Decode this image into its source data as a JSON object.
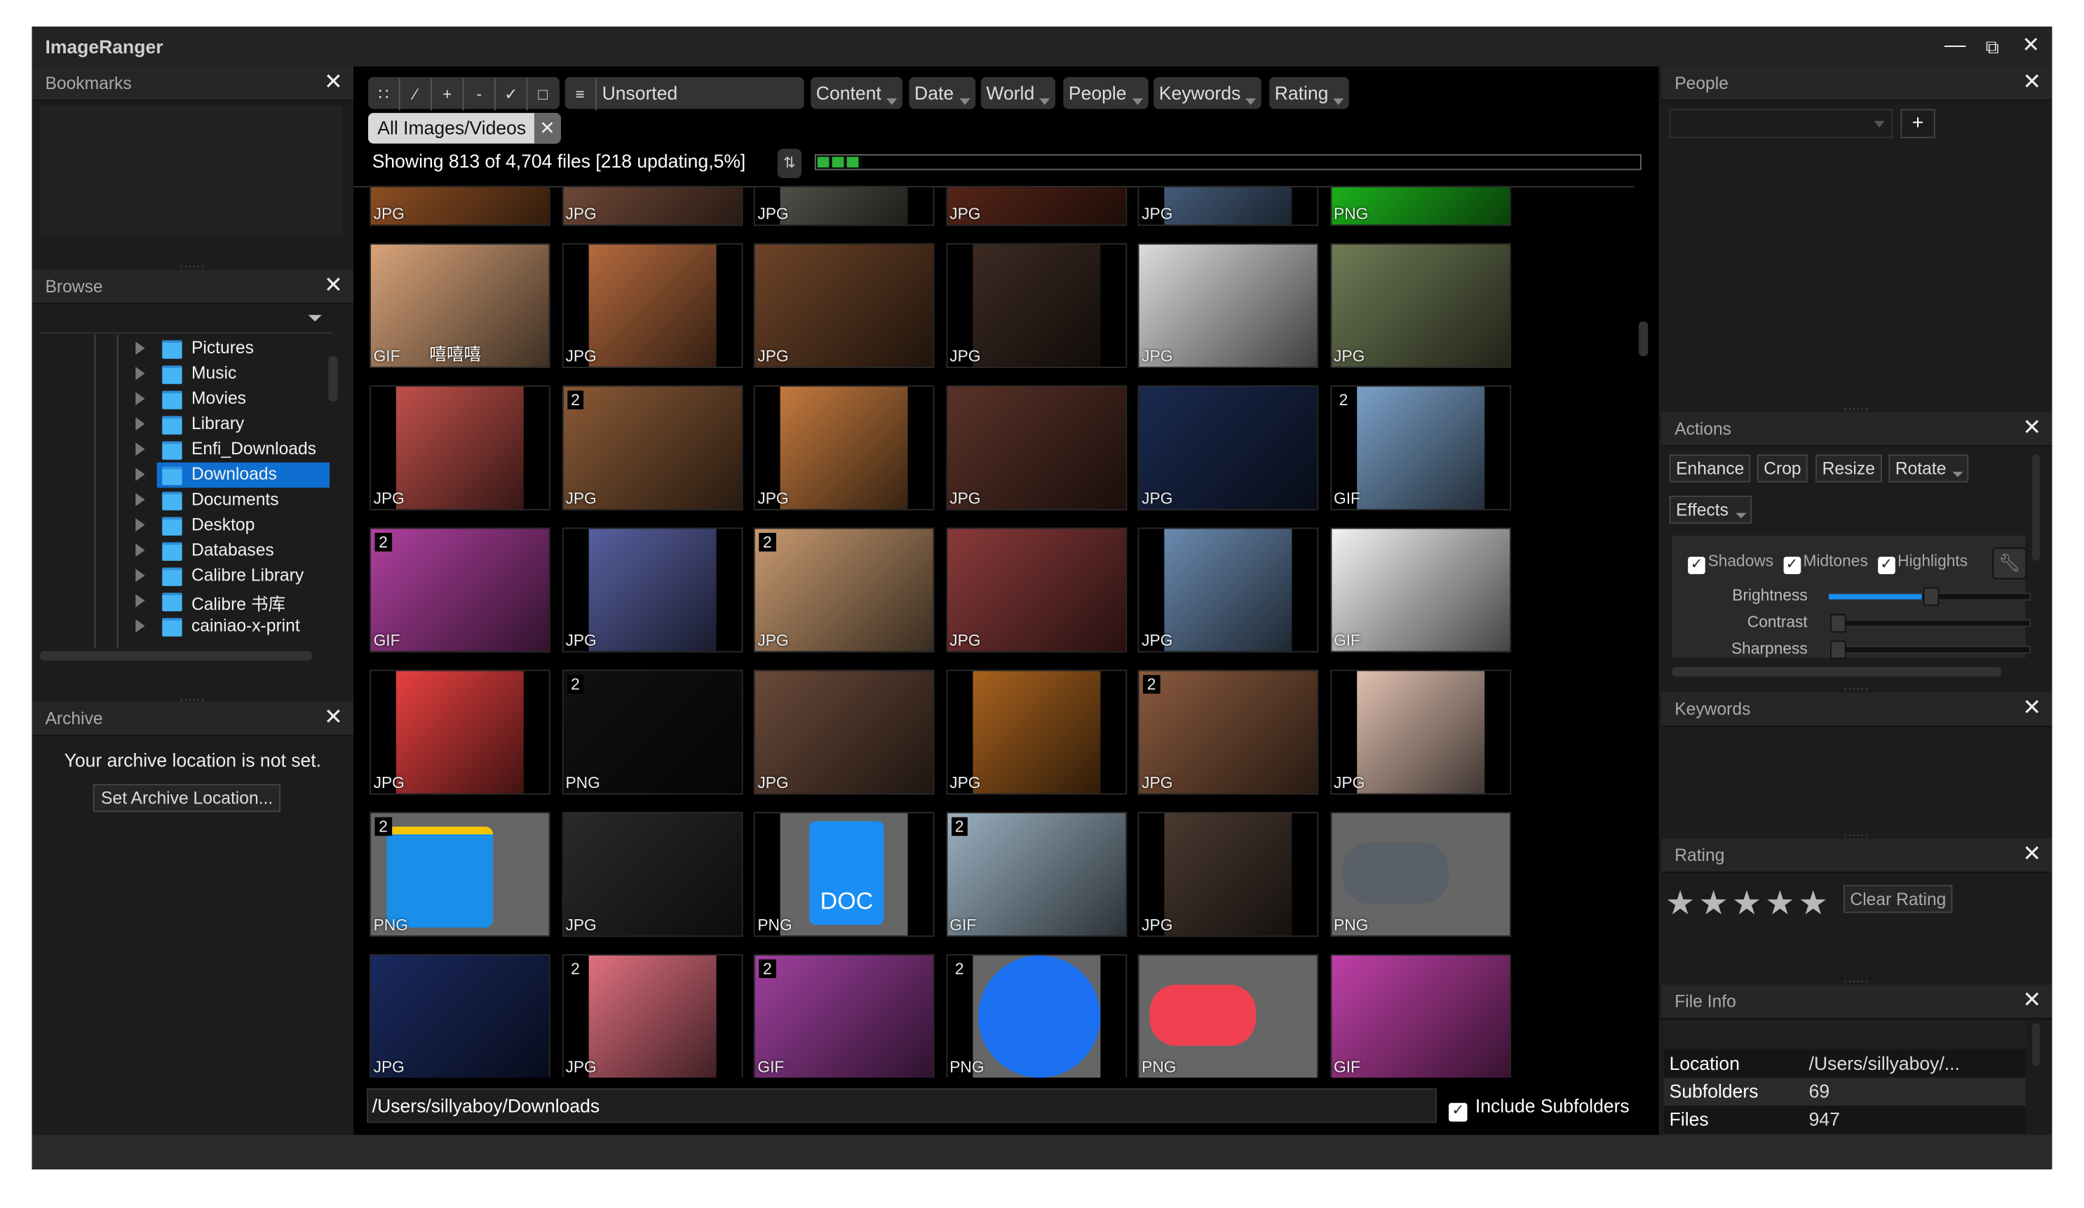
{
  "window": {
    "title": "ImageRanger",
    "controls": [
      "minimize-icon",
      "restore-icon",
      "close-icon"
    ]
  },
  "left": {
    "bookmarks": {
      "title": "Bookmarks"
    },
    "browse": {
      "title": "Browse",
      "folders": [
        {
          "label": "Pictures"
        },
        {
          "label": "Music"
        },
        {
          "label": "Movies"
        },
        {
          "label": "Library"
        },
        {
          "label": "Enfi_Downloads"
        },
        {
          "label": "Downloads",
          "selected": true
        },
        {
          "label": "Documents"
        },
        {
          "label": "Desktop"
        },
        {
          "label": "Databases"
        },
        {
          "label": "Calibre Library"
        },
        {
          "label": "Calibre 书库"
        },
        {
          "label": "cainiao-x-print"
        }
      ]
    },
    "archive": {
      "title": "Archive",
      "message": "Your archive location is not set.",
      "button": "Set Archive Location..."
    }
  },
  "toolbar": {
    "sort": "Unsorted",
    "filters": [
      "Content",
      "Date",
      "World",
      "People",
      "Keywords",
      "Rating"
    ],
    "chip": "All Images/Videos",
    "status": "Showing 813 of 4,704 files [218 updating,5%]",
    "progress_percent": 5,
    "progress_color": "#2fb33a"
  },
  "grid": {
    "tiles": [
      {
        "type": "JPG",
        "color": "#b0622c"
      },
      {
        "type": "JPG",
        "color": "#8a5a45"
      },
      {
        "type": "JPG",
        "color": "#6a6a60"
      },
      {
        "type": "JPG",
        "color": "#6b2e1e"
      },
      {
        "type": "JPG",
        "color": "#5a78a0"
      },
      {
        "type": "PNG",
        "color": "#22dd22"
      },
      {
        "type": "GIF",
        "color": "#d9a47a",
        "caption": "嘻嘻嘻"
      },
      {
        "type": "JPG",
        "color": "#b56a3e"
      },
      {
        "type": "JPG",
        "color": "#6e4428"
      },
      {
        "type": "JPG",
        "color": "#3c2a22"
      },
      {
        "type": "JPG",
        "color": "#dcdcdc"
      },
      {
        "type": "JPG",
        "color": "#6f7a55"
      },
      {
        "type": "JPG",
        "color": "#c0504a"
      },
      {
        "type": "JPG",
        "count": "2",
        "color": "#8a5a36"
      },
      {
        "type": "JPG",
        "color": "#c47a3e"
      },
      {
        "type": "JPG",
        "color": "#5a3228"
      },
      {
        "type": "JPG",
        "color": "#1a2a50"
      },
      {
        "type": "GIF",
        "count": "2",
        "color": "#7aa0c8"
      },
      {
        "type": "GIF",
        "count": "2",
        "color": "#b040a0"
      },
      {
        "type": "JPG",
        "color": "#5860a0"
      },
      {
        "type": "JPG",
        "count": "2",
        "color": "#c89a70"
      },
      {
        "type": "JPG",
        "color": "#8a3a3a"
      },
      {
        "type": "JPG",
        "color": "#6a8ab0"
      },
      {
        "type": "GIF",
        "color": "#f2f2f2"
      },
      {
        "type": "JPG",
        "color": "#e84040"
      },
      {
        "type": "PNG",
        "count": "2",
        "color": "#111111"
      },
      {
        "type": "JPG",
        "color": "#6a4a3a"
      },
      {
        "type": "JPG",
        "color": "#a8621e"
      },
      {
        "type": "JPG",
        "count": "2",
        "color": "#8a5a3e"
      },
      {
        "type": "JPG",
        "color": "#e0c0b0"
      },
      {
        "type": "PNG",
        "count": "2",
        "color": "#1a8ee8",
        "icon": "folder-icon"
      },
      {
        "type": "JPG",
        "color": "#2a2a2a"
      },
      {
        "type": "PNG",
        "color": "#1a8ef5",
        "label": "DOC"
      },
      {
        "type": "GIF",
        "count": "2",
        "color": "#9ab0c0"
      },
      {
        "type": "JPG",
        "color": "#4a3a30"
      },
      {
        "type": "PNG",
        "color": "#5a6068",
        "icon": "gamepad-icon"
      },
      {
        "type": "JPG",
        "color": "#1a2a60"
      },
      {
        "type": "JPG",
        "count": "2",
        "color": "#e07080"
      },
      {
        "type": "GIF",
        "count": "2",
        "color": "#a040a0"
      },
      {
        "type": "PNG",
        "count": "2",
        "color": "#1a70f0",
        "icon": "app-store-icon"
      },
      {
        "type": "PNG",
        "color": "#f04050",
        "icon": "gamepad-icon"
      },
      {
        "type": "GIF",
        "color": "#c040a8"
      }
    ]
  },
  "footer": {
    "path": "/Users/sillyaboy/Downloads",
    "include_subfolders": "Include Subfolders",
    "include_checked": true
  },
  "right": {
    "people": {
      "title": "People",
      "add": "+"
    },
    "actions": {
      "title": "Actions",
      "buttons": [
        "Enhance",
        "Crop",
        "Resize",
        "Rotate"
      ],
      "effects": "Effects",
      "checks": [
        "Shadows",
        "Midtones",
        "Highlights"
      ],
      "sliders": [
        {
          "label": "Brightness",
          "value": 0.5
        },
        {
          "label": "Contrast",
          "value": 0
        },
        {
          "label": "Sharpness",
          "value": 0
        }
      ]
    },
    "keywords": {
      "title": "Keywords"
    },
    "rating": {
      "title": "Rating",
      "stars": 5,
      "clear": "Clear Rating"
    },
    "fileinfo": {
      "title": "File Info",
      "rows": [
        {
          "key": "Location",
          "value": "/Users/sillyaboy/..."
        },
        {
          "key": "Subfolders",
          "value": "69"
        },
        {
          "key": "Files",
          "value": "947"
        }
      ]
    }
  }
}
